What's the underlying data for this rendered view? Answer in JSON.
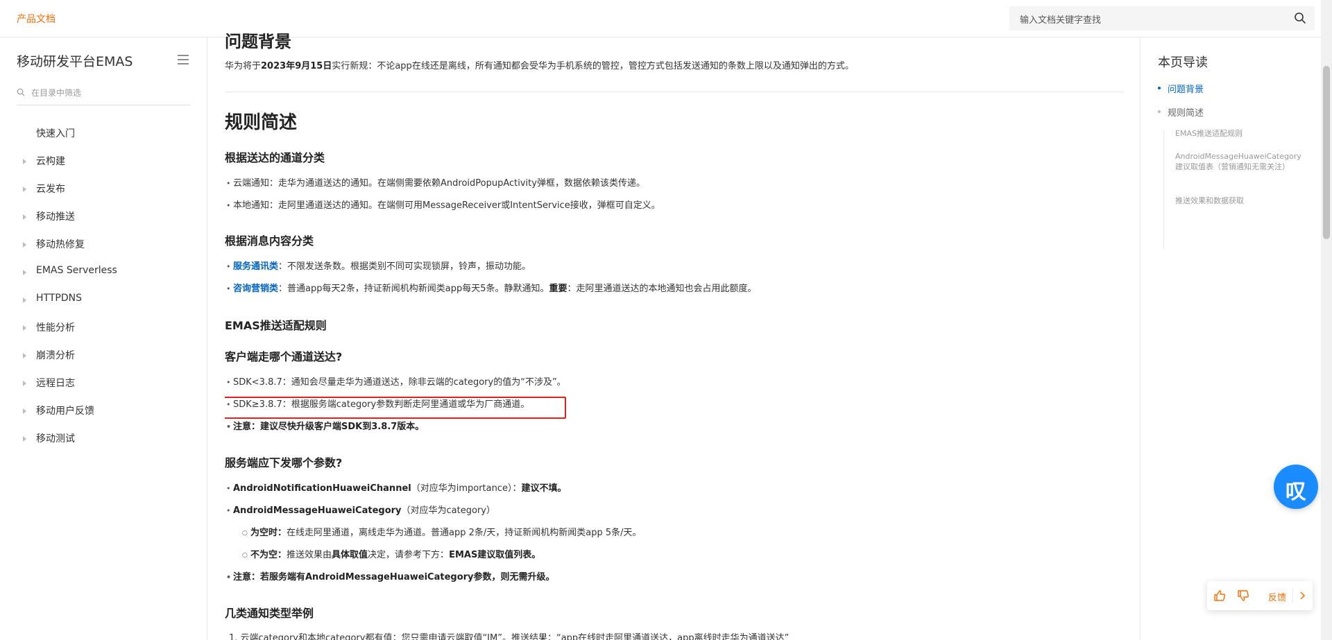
{
  "header": {
    "brand": "产品文档",
    "search_placeholder": "输入文档关键字查找"
  },
  "sidebar": {
    "title": "移动研发平台EMAS",
    "filter_placeholder": "在目录中筛选",
    "items": [
      {
        "label": "快速入门",
        "expandable": false
      },
      {
        "label": "云构建",
        "expandable": true
      },
      {
        "label": "云发布",
        "expandable": true
      },
      {
        "label": "移动推送",
        "expandable": true
      },
      {
        "label": "移动热修复",
        "expandable": true
      },
      {
        "label": "EMAS Serverless",
        "expandable": true
      },
      {
        "label": "HTTPDNS",
        "expandable": true
      },
      {
        "label": "性能分析",
        "expandable": true
      },
      {
        "label": "崩溃分析",
        "expandable": true
      },
      {
        "label": "远程日志",
        "expandable": true
      },
      {
        "label": "移动用户反馈",
        "expandable": true
      },
      {
        "label": "移动测试",
        "expandable": true
      }
    ]
  },
  "content": {
    "h2_background": "问题背景",
    "intro_a": "华为将于",
    "intro_date": "2023年9月15日",
    "intro_b": "实行新规：不论app在线还是离线，所有通知都会受华为手机系统的管控，管控方式包括发送通知的条数上限以及通知弹出的方式。",
    "h2_rules": "规则简述",
    "h3_channel": "根据送达的通道分类",
    "channel_1": "云端通知：走华为通道送达的通知。在端侧需要依赖AndroidPopupActivity弹框，数据依赖该类传递。",
    "channel_2": "本地通知：走阿里通道送达的通知。在端侧可用MessageReceiver或IntentService接收，弹框可自定义。",
    "h3_content": "根据消息内容分类",
    "service_link": "服务通讯类",
    "service_text": "：不限发送条数。根据类别不同可实现锁屏，铃声，振动功能。",
    "marketing_link": "咨询营销类",
    "marketing_text": "：普通app每天2条，持证新闻机构新闻类app每天5条。静默通知。",
    "marketing_important": "重要",
    "marketing_tail": "：走阿里通道送达的本地通知也会占用此额度。",
    "h3_emas": "EMAS推送适配规则",
    "h3_client": "客户端走哪个通道送达?",
    "sdk_old": "SDK<3.8.7：通知会尽量走华为通道送达，除非云端的category的值为“不涉及”。",
    "sdk_new": "SDK≥3.8.7：根据服务端category参数判断走阿里通道或华为厂商通道。",
    "sdk_note": "注意：建议尽快升级客户端SDK到3.8.7版本。",
    "h3_server": "服务端应下发哪个参数?",
    "param_channel_name": "AndroidNotificationHuaweiChannel",
    "param_channel_desc": "（对应华为importance）：",
    "param_channel_advice": "建议不填。",
    "param_category_name": "AndroidMessageHuaweiCategory",
    "param_category_desc": "（对应华为category）",
    "empty_label": "为空时：",
    "empty_text": "在线走阿里通道，离线走华为通道。普通app 2条/天，持证新闻机构新闻类app 5条/天。",
    "nonempty_label": "不为空：",
    "nonempty_text_a": "推送效果由",
    "nonempty_bold": "具体取值",
    "nonempty_text_b": "决定，请参考下方：",
    "nonempty_ref": "EMAS建议取值列表。",
    "server_note": "注意：若服务端有AndroidMessageHuaweiCategory参数，则无需升级。",
    "h3_examples": "几类通知类型举例",
    "example_1": "1. 云端category和本地category都有值：您只需申请云端取值“IM”。推送结果：“app在线时走阿里通道送达，app离线时走华为通道送达”"
  },
  "toc": {
    "title": "本页导读",
    "items": [
      {
        "label": "问题背景",
        "active": true
      },
      {
        "label": "规则简述",
        "active": false
      }
    ],
    "sub_items": [
      "EMAS推送适配规则",
      "AndroidMessageHuaweiCategory建议取值表（营销通知无需关注）",
      "推送效果和数据获取"
    ]
  },
  "floating": {
    "logo_text": "叹",
    "feedback_label": "反馈"
  },
  "colors": {
    "brand": "#ff6a00",
    "link": "#0064c8",
    "highlight": "#e02020",
    "float_logo": "#1a8cff"
  }
}
